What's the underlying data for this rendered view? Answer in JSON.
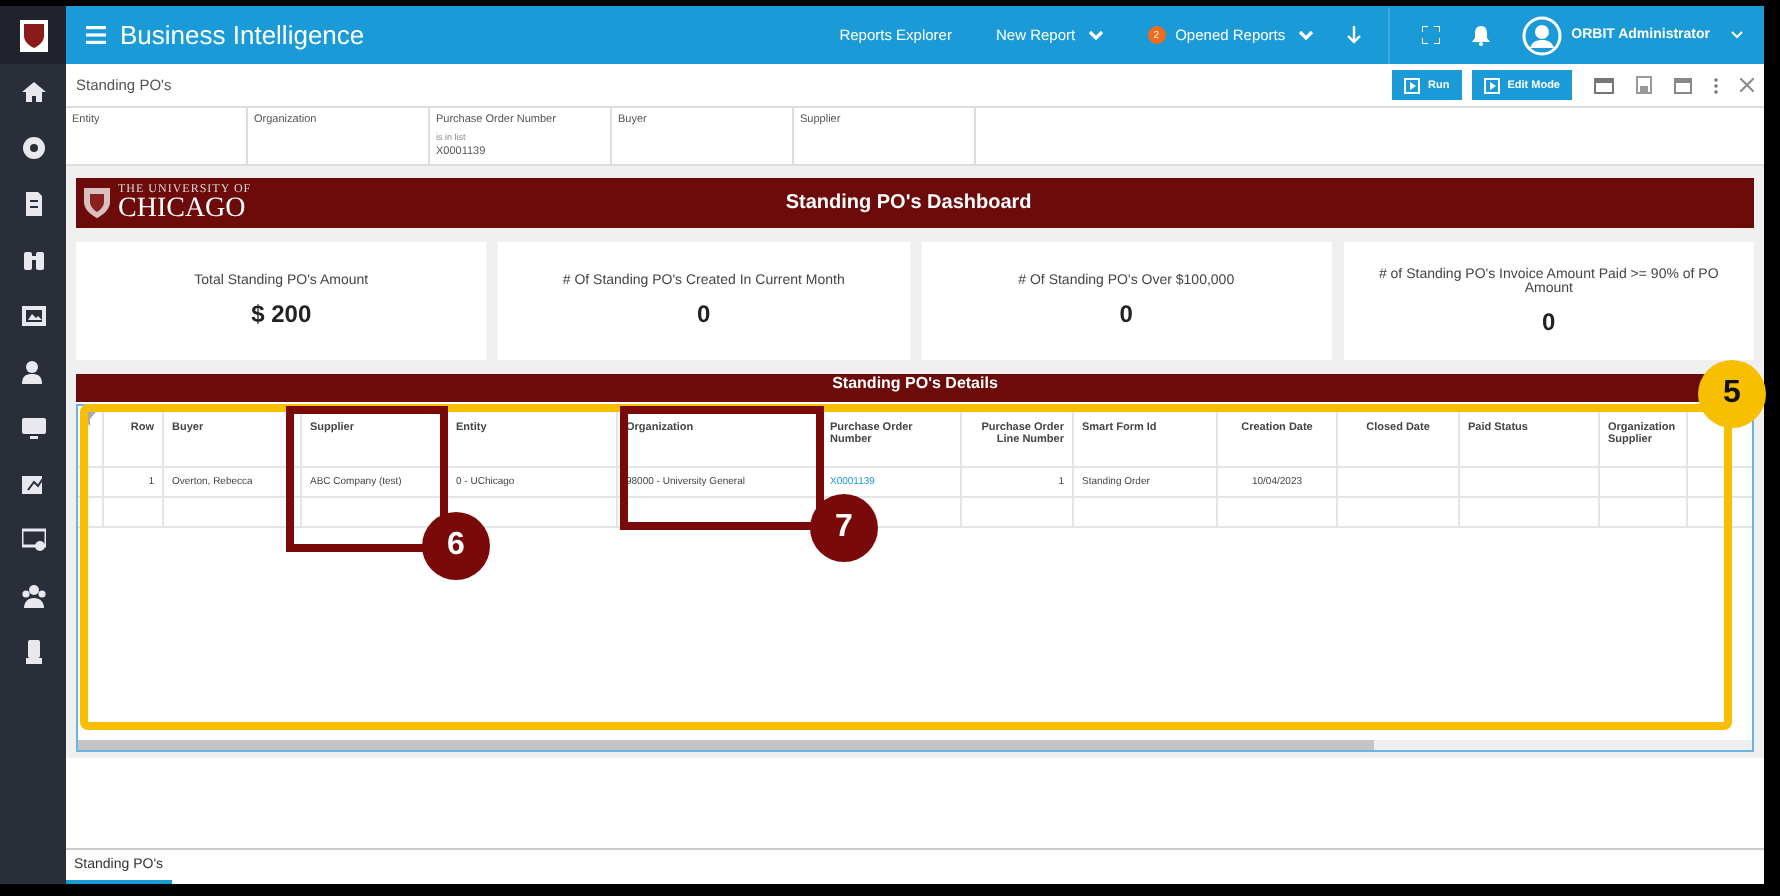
{
  "app": {
    "title": "Business Intelligence",
    "nav": [
      {
        "label": "Reports Explorer",
        "dropdown": false
      },
      {
        "label": "New Report",
        "dropdown": true
      },
      {
        "label": "Opened Reports",
        "dropdown": true,
        "badge": "2"
      }
    ],
    "user": "ORBIT Administrator"
  },
  "report": {
    "title": "Standing PO's",
    "buttons": [
      "Run",
      "Edit Mode"
    ]
  },
  "filters": [
    {
      "label": "Entity"
    },
    {
      "label": "Organization"
    },
    {
      "label": "Purchase Order Number",
      "operator": "is in list",
      "value": "X0001139"
    },
    {
      "label": "Buyer"
    },
    {
      "label": "Supplier"
    }
  ],
  "banner": {
    "logo_top": "THE UNIVERSITY OF",
    "logo_main": "CHICAGO",
    "title": "Standing PO's Dashboard"
  },
  "kpis": [
    {
      "label": "Total Standing PO's Amount",
      "value": "$ 200"
    },
    {
      "label": "# Of Standing PO's Created In Current Month",
      "value": "0"
    },
    {
      "label": "# Of Standing PO's Over $100,000",
      "value": "0"
    },
    {
      "label": "# of Standing PO's Invoice Amount Paid >= 90% of PO Amount",
      "value": "0"
    }
  ],
  "details": {
    "title": "Standing PO's Details",
    "columns": [
      "Row",
      "Buyer",
      "Supplier",
      "Entity",
      "Organization",
      "Purchase Order Number",
      "Purchase Order Line Number",
      "Smart Form Id",
      "Creation Date",
      "Closed Date",
      "Paid Status",
      "Organization Supplier"
    ],
    "rows": [
      {
        "cells": [
          "1",
          "Overton, Rebecca",
          "ABC Company (test)",
          "0 - UChicago",
          "98000 - University General",
          "X0001139",
          "1",
          "Standing Order",
          "10/04/2023"
        ]
      }
    ]
  },
  "bottom_tabs": [
    {
      "label": "Standing PO's",
      "selected": true
    }
  ],
  "callouts": [
    {
      "number": "5",
      "kind": "frame"
    },
    {
      "number": "6",
      "kind": "box"
    },
    {
      "number": "7",
      "kind": "box"
    }
  ]
}
